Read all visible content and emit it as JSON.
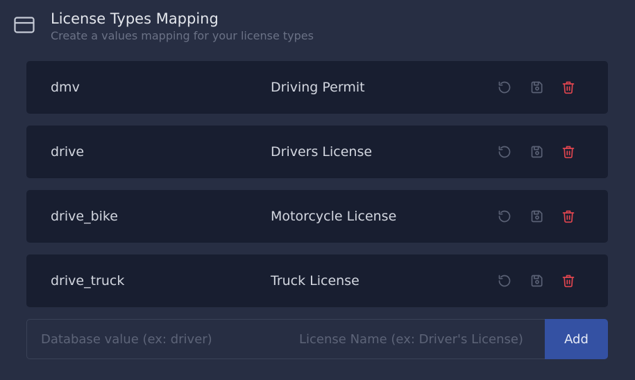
{
  "section": {
    "icon": "credit-card-icon",
    "title": "License Types Mapping",
    "subtitle": "Create a values mapping for your license types"
  },
  "mappings": [
    {
      "key": "dmv",
      "value": "Driving Permit"
    },
    {
      "key": "drive",
      "value": "Drivers License"
    },
    {
      "key": "drive_bike",
      "value": "Motorcycle License"
    },
    {
      "key": "drive_truck",
      "value": "Truck License"
    }
  ],
  "row_actions": {
    "reset_icon": "reset-icon",
    "save_icon": "save-icon",
    "delete_icon": "trash-icon"
  },
  "add_form": {
    "db_value_placeholder": "Database value (ex: driver)",
    "license_name_placeholder": "License Name (ex: Driver's License)",
    "add_label": "Add"
  },
  "colors": {
    "background": "#272e43",
    "row_background": "#181e30",
    "accent": "#3451a3",
    "delete": "#e2464f",
    "muted_icon": "#5b6276"
  }
}
